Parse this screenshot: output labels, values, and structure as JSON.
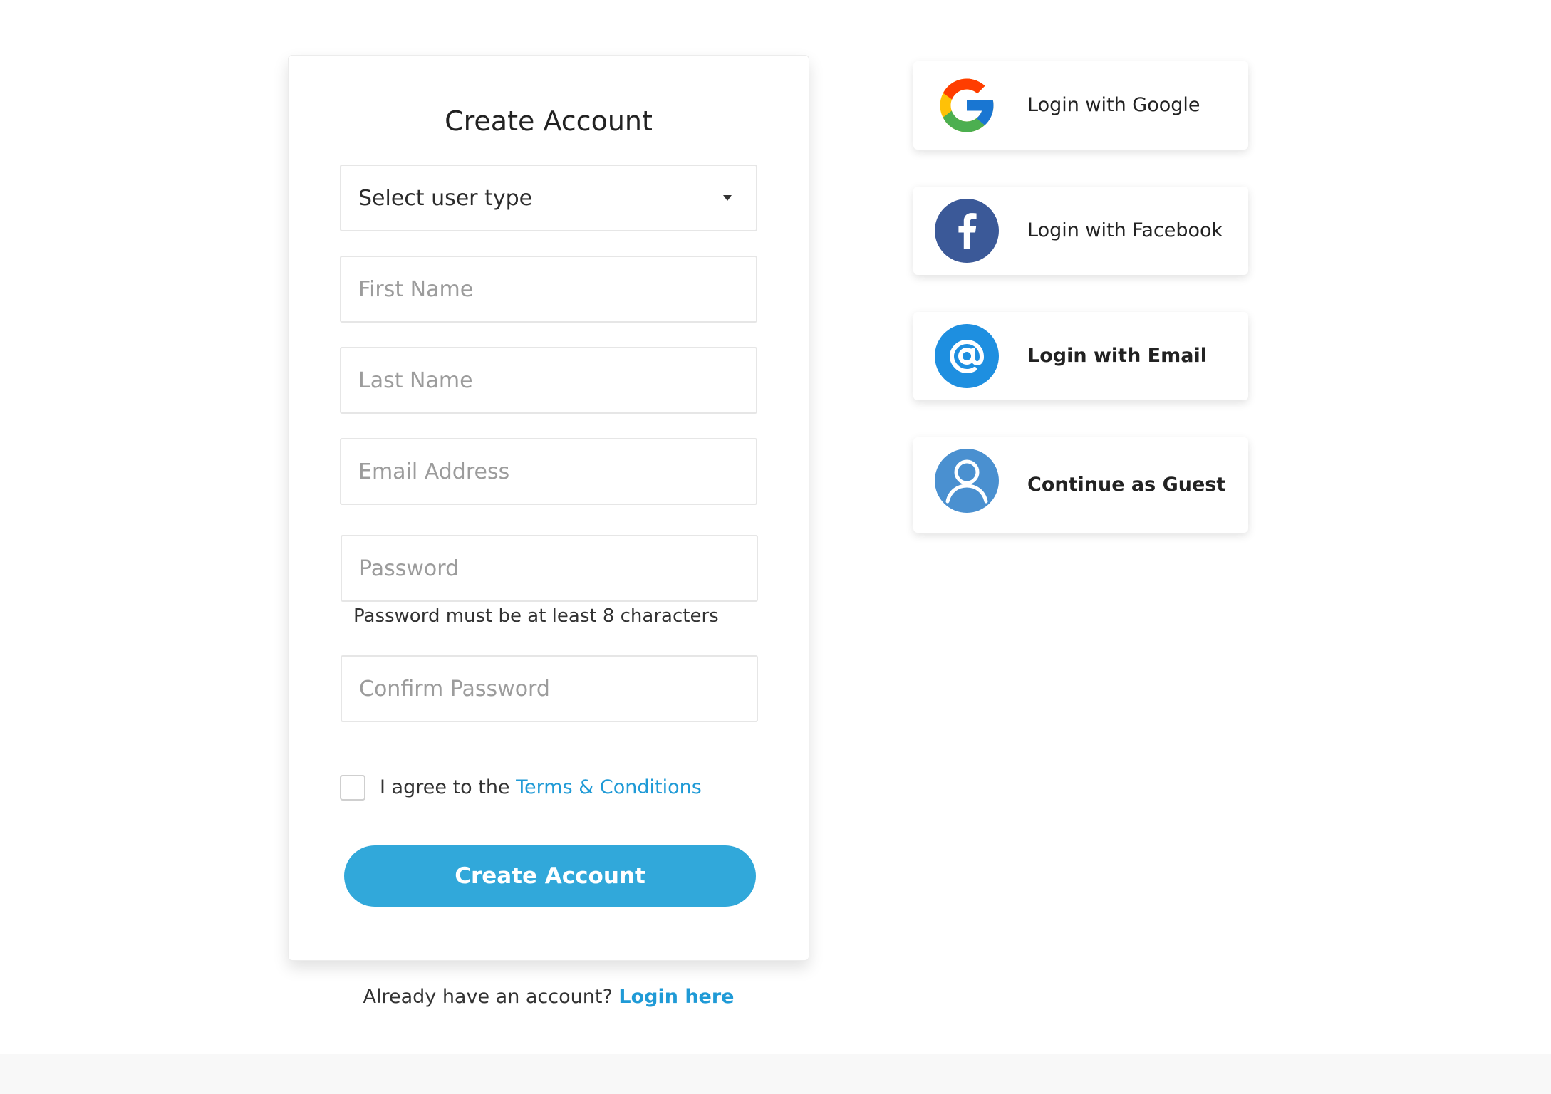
{
  "signup": {
    "title": "Create Account",
    "user_type": {
      "selected": "Select user type"
    },
    "first_name": {
      "placeholder": "First Name",
      "value": ""
    },
    "last_name": {
      "placeholder": "Last Name",
      "value": ""
    },
    "email": {
      "placeholder": "Email Address",
      "value": ""
    },
    "password": {
      "placeholder": "Password",
      "value": ""
    },
    "password_hint": "Password must be at least 8 characters",
    "confirm_password": {
      "placeholder": "Confirm Password",
      "value": ""
    },
    "agree_prefix": "I agree to the ",
    "terms_link": "Terms & Conditions",
    "submit_label": "Create Account"
  },
  "login_prompt": {
    "text": "Already have an account? ",
    "link": "Login here"
  },
  "social": {
    "google": {
      "label": "Login with Google",
      "icon": "google-icon"
    },
    "facebook": {
      "label": "Login with Facebook",
      "icon": "facebook-icon"
    },
    "email": {
      "label": "Login with Email",
      "icon": "at-sign-icon"
    },
    "guest": {
      "label": "Continue as Guest",
      "icon": "user-icon"
    }
  },
  "colors": {
    "accent": "#31a8da",
    "link": "#1f9ad6",
    "facebook": "#3b5998",
    "email": "#1e8fe0",
    "guest": "#4a90d0"
  }
}
